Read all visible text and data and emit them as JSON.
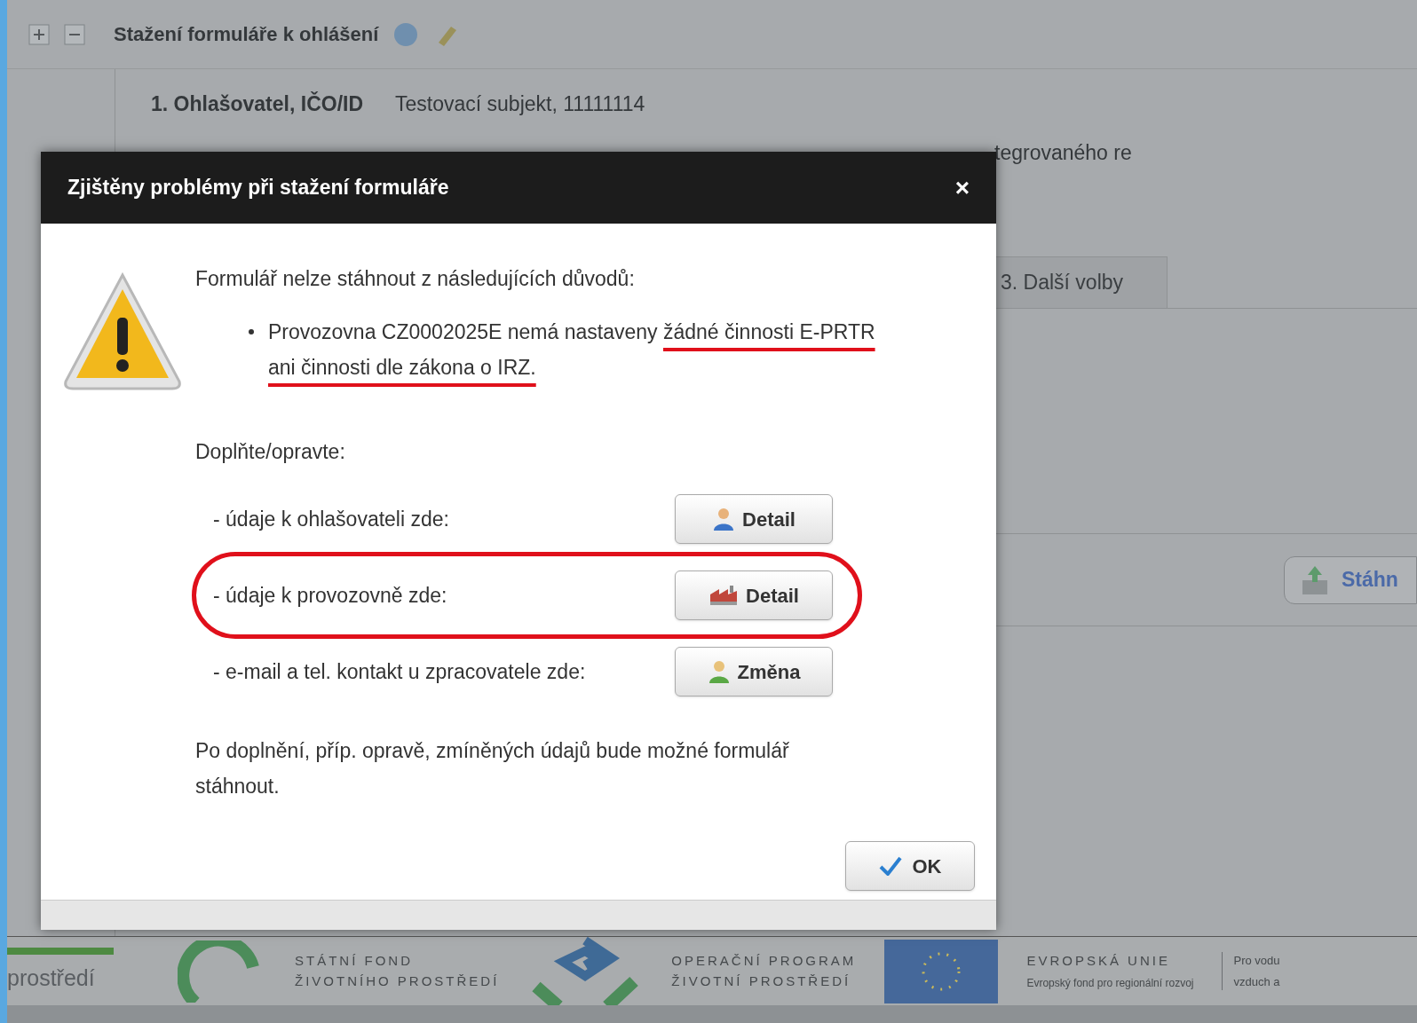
{
  "page": {
    "section_title": "Stažení formuláře k ohlášení",
    "fields": [
      {
        "label": "1. Ohlašovatel, IČO/ID",
        "value": "Testovací subjekt, 11111114"
      }
    ],
    "covered_fragment": "tegrovaného re",
    "tab": {
      "label": "3. Další volby",
      "selected": false
    },
    "download_button": "Stáhn"
  },
  "footer": {
    "left_text": "prostředí",
    "fund": [
      "STÁTNÍ FOND",
      "ŽIVOTNÍHO PROSTŘEDÍ"
    ],
    "program": [
      "OPERAČNÍ PROGRAM",
      "ŽIVOTNÍ PROSTŘEDÍ"
    ],
    "eu": [
      "EVROPSKÁ UNIE",
      "Evropský fond pro regionální rozvoj"
    ],
    "slogan": [
      "Pro vodu",
      "vzduch a"
    ]
  },
  "dialog": {
    "title": "Zjištěny problémy při stažení formuláře",
    "close": "×",
    "intro": "Formulář nelze stáhnout z následujících důvodů:",
    "reasons": [
      {
        "text": "Provozovna CZ0002025E nemá nastaveny ",
        "underlined": "žádné činnosti E-PRTR ani činnosti dle zákona o IRZ."
      }
    ],
    "fix_label": "Doplňte/opravte:",
    "fix_rows": [
      {
        "label": "- údaje k ohlašovateli zde:",
        "button": "Detail",
        "kind": "person",
        "highlighted": false
      },
      {
        "label": "- údaje k provozovně zde:",
        "button": "Detail",
        "kind": "building",
        "highlighted": true
      },
      {
        "label": "- e-mail a tel. kontakt u zpracovatele zde:",
        "button": "Změna",
        "kind": "contact",
        "highlighted": false
      }
    ],
    "outro": "Po doplnění, příp. opravě, zmíněných údajů bude možné formulář stáhnout.",
    "ok": "OK"
  }
}
